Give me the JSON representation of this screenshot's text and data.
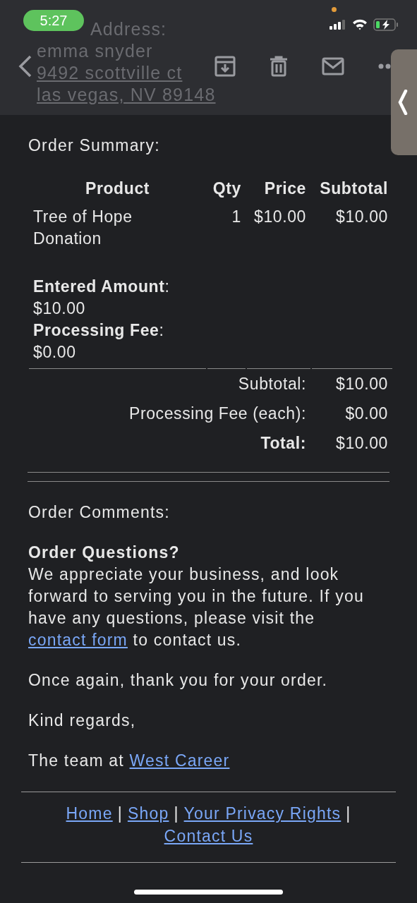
{
  "status_bar": {
    "time": "5:27"
  },
  "background_text": [
    "Address:",
    "emma snyder",
    "9492 scottville ct",
    "las vegas, NV 89148"
  ],
  "order_summary": {
    "title": "Order Summary:",
    "columns": [
      "Product",
      "Qty",
      "Price",
      "Subtotal"
    ],
    "rows": [
      {
        "product": "Tree of Hope Donation",
        "qty": "1",
        "price": "$10.00",
        "subtotal": "$10.00"
      }
    ],
    "details": [
      {
        "label": "**Entered Amount**:",
        "value": "$10.00"
      },
      {
        "label": "**Processing Fee**:",
        "value": "$0.00"
      }
    ],
    "totals": [
      {
        "label": "Subtotal:",
        "value": "$10.00",
        "bold": false
      },
      {
        "label": "Processing Fee (each):",
        "value": "$0.00",
        "bold": false
      },
      {
        "label": "Total:",
        "value": "$10.00",
        "bold": true
      }
    ]
  },
  "comments_title": "Order Comments:",
  "questions": {
    "title": "Order Questions?",
    "text_before": "We appreciate your business, and look forward to serving you in the future. If you have any questions, please visit the",
    "link": "contact form",
    "text_after": "to contact us."
  },
  "paragraphs": [
    "Once again, thank you for your order.",
    "Kind regards,"
  ],
  "signoff": {
    "text": "The team at",
    "link": "West Career"
  },
  "footer": {
    "separator": "|",
    "links": [
      "Home",
      "Shop",
      "Your Privacy Rights",
      "Contact Us"
    ]
  }
}
